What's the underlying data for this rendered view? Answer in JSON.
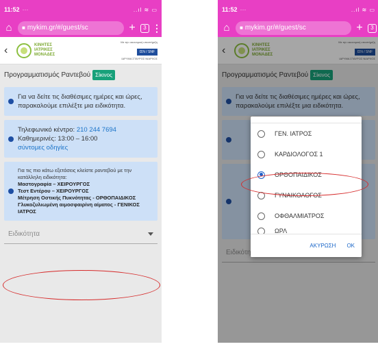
{
  "status": {
    "time": "11:52",
    "dots": "···",
    "icons": "..ıl ≋ ▭"
  },
  "browser": {
    "url": "mykim.gr/#/guest/sc",
    "new_tab": "+",
    "tab_count": "3",
    "menu": "⋮"
  },
  "site": {
    "logo_lines": [
      "ΚΙΝΗΤΕΣ",
      "ΙΑΤΡΙΚΕΣ",
      "ΜΟΝΑΔΕΣ"
    ],
    "sponsor_tiny_top": "Με την οικονομική υποστήριξη",
    "sponsor_badge": "ΙΣΝ / SNF",
    "sponsor_tiny_bottom": "ΙΔΡΥΜΑ ΣΤΑΥΡΟΣ ΝΙΑΡΧΟΣ"
  },
  "left": {
    "title": "Προγραμματισμός Ραντεβού",
    "tag": "Σίκινος",
    "info1": "Για να δείτε τις διαθέσιμες ημέρες και ώρες, παρακαλούμε επιλέξτε μια ειδικότητα.",
    "call_center_label": "Τηλεφωνικό κέντρο:",
    "call_center_phone": "210 244 7694",
    "weekdays": "Καθημερινές: 13:00 – 16:00",
    "short_guide": "σύντομες οδηγίες",
    "info3_intro": "Για τις πιο κάτω εξετάσεις κλείστε ραντεβού με την κατάλληλη ειδικότητα:",
    "info3_items": [
      "Μαστογραφία – ΧΕΙΡΟΥΡΓΟΣ",
      "Τεστ Εντέρου – ΧΕΙΡΟΥΡΓΟΣ",
      "Μέτρηση Οστικής Πυκνότητας - ΟΡΘΟΠΑΙΔΙΚΟΣ",
      "Γλυκοζυλιωμένη αιμοσφαιρίνη αίματος - ΓΕΝΙΚΟΣ ΙΑΤΡΟΣ"
    ],
    "select_placeholder": "Ειδικότητα"
  },
  "right": {
    "title": "Προγραμματισμός Ραντεβού",
    "tag": "Σίκινος",
    "info1": "Για να δείτε τις διαθέσιμες ημέρες και ώρες, παρακαλούμε επιλέξτε μια ειδικότητα.",
    "select_placeholder": "Ειδικότητα",
    "options": [
      "ΓΕΝ. ΙΑΤΡΟΣ",
      "ΚΑΡΔΙΟΛΟΓΟΣ 1",
      "ΟΡΘΟΠΑΙΔΙΚΟΣ",
      "ΓΥΝΑΙΚΟΛΟΓΟΣ",
      "ΟΦΘΑΛΜΙΑΤΡΟΣ",
      "ΩΡΛ"
    ],
    "selected_option": "ΟΡΘΟΠΑΙΔΙΚΟΣ",
    "cancel": "ΑΚΥΡΩΣΗ",
    "ok": "OK"
  },
  "colors": {
    "browser_bar": "#e83fc4",
    "tag": "#17a17a",
    "info_bg": "#cde0f7",
    "highlight": "#d62a2a",
    "radio_on": "#1f5fc8"
  }
}
